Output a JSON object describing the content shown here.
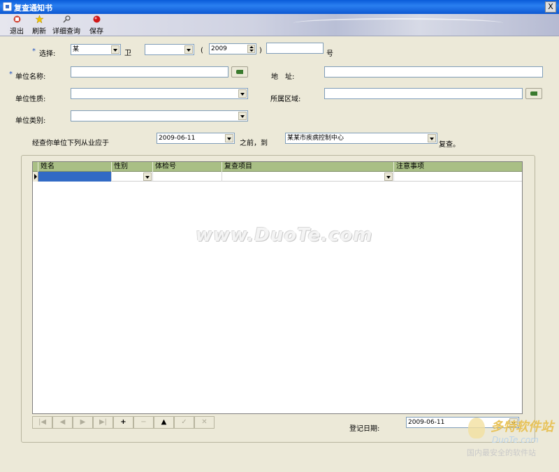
{
  "window": {
    "title": "复查通知书",
    "close_glyph": "X"
  },
  "toolbar": {
    "exit": "退出",
    "refresh": "刷新",
    "detail_query": "详细查询",
    "save": "保存"
  },
  "form": {
    "select_label": "选择:",
    "select_value": "某",
    "wei": "卫",
    "wei_value": "",
    "paren_open": "(",
    "year_value": "2009",
    "paren_close": ")",
    "number_value": "",
    "hao": "号",
    "unit_name_label": "单位名称:",
    "unit_name_value": "",
    "address_label": "地　址:",
    "address_value": "",
    "unit_nature_label": "单位性质:",
    "unit_nature_value": "",
    "region_label": "所属区域:",
    "region_value": "",
    "unit_category_label": "单位类别:",
    "unit_category_value": "",
    "sentence_prefix": "经查你单位下列从业应于",
    "date_value": "2009-06-11",
    "before_to": "之前，到",
    "center_value": "某某市疾病控制中心",
    "recheck": "复查。",
    "required_mark": "*"
  },
  "grid": {
    "columns": [
      "姓名",
      "性别",
      "体检号",
      "复查项目",
      "注意事项"
    ]
  },
  "nav": [
    "|◀",
    "◀",
    "▶",
    "▶|",
    "+",
    "−",
    "▲",
    "✓",
    "✕"
  ],
  "register": {
    "label": "登记日期:",
    "date_value": "2009-06-11"
  },
  "watermark": {
    "text": "www.DuoTe.com"
  },
  "corner_logo": {
    "brand": "多特软件站",
    "site": "DuoTe.com",
    "slogan": "国内最安全的软件站"
  }
}
